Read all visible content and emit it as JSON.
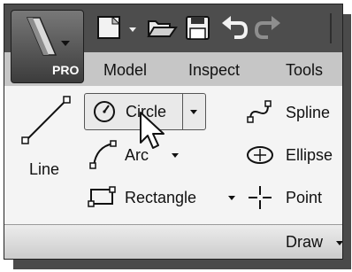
{
  "app": {
    "badge": "PRO"
  },
  "tabs": [
    {
      "label": "Model"
    },
    {
      "label": "Inspect"
    },
    {
      "label": "Tools"
    }
  ],
  "draw": {
    "line": "Line",
    "circle": "Circle",
    "arc": "Arc",
    "rectangle": "Rectangle",
    "spline": "Spline",
    "ellipse": "Ellipse",
    "point": "Point"
  },
  "panel_title": "Draw",
  "icons": {
    "new": "new-file-icon",
    "open": "open-folder-icon",
    "save": "save-icon",
    "undo": "undo-icon",
    "redo": "redo-icon"
  }
}
